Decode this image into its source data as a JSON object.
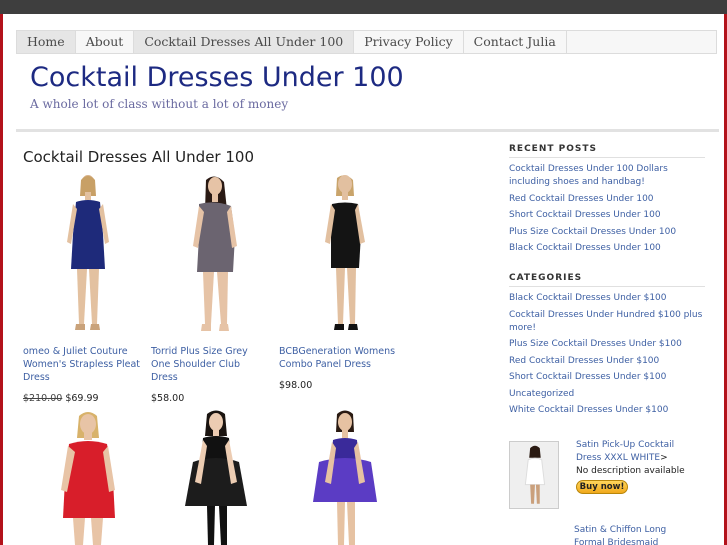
{
  "nav": {
    "items": [
      "Home",
      "About",
      "Cocktail Dresses All Under 100",
      "Privacy Policy",
      "Contact Julia"
    ]
  },
  "site": {
    "title": "Cocktail Dresses Under 100",
    "tagline": "A whole lot of class without a lot of money"
  },
  "content": {
    "title": "Cocktail Dresses All Under 100",
    "products": [
      {
        "name": "omeo & Juliet Couture Women's Strapless Pleat Dress",
        "old_price": "$210.00",
        "price": "$69.99"
      },
      {
        "name": "Torrid Plus Size Grey One Shoulder Club Dress",
        "old_price": "",
        "price": "$58.00"
      },
      {
        "name": "BCBGeneration Womens Combo Panel Dress",
        "old_price": "",
        "price": "$98.00"
      }
    ]
  },
  "sidebar": {
    "recent_title": "RECENT POSTS",
    "recent_posts": [
      "Cocktail Dresses Under 100 Dollars including shoes and handbag!",
      "Red Cocktail Dresses Under 100",
      "Short Cocktail Dresses Under 100",
      "Plus Size Cocktail Dresses Under 100",
      "Black Cocktail Dresses Under 100"
    ],
    "categories_title": "CATEGORIES",
    "categories": [
      "Black Cocktail Dresses Under $100",
      "Cocktail Dresses Under Hundred $100 plus more!",
      "Plus Size Cocktail Dresses Under $100",
      "Red Cocktail Dresses Under $100",
      "Short Cocktail Dresses Under $100",
      "Uncategorized",
      "White Cocktail Dresses Under $100"
    ],
    "ad": {
      "title": "Satin Pick-Up Cocktail Dress XXXL WHITE",
      "arrow": ">",
      "desc": "No description available",
      "buy_label": "Buy now!"
    },
    "ad2_title": "Satin & Chiffon Long Formal Bridesmaid"
  },
  "colors": {
    "brand_title": "#1d2a82",
    "link": "#3d5fa3",
    "frame": "#b3121b"
  }
}
